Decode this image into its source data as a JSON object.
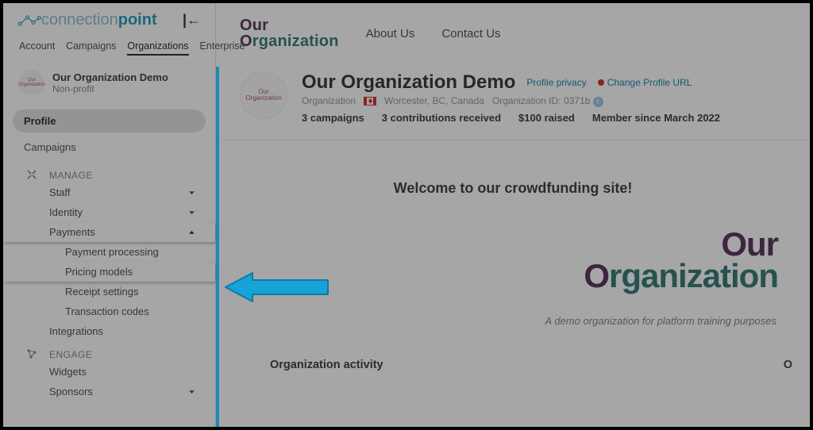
{
  "brand": {
    "logo_light": "connection",
    "logo_bold": "point",
    "org_word1": "Our",
    "org_word2": "Organization"
  },
  "top_tabs": [
    "Account",
    "Campaigns",
    "Organizations",
    "Enterprise"
  ],
  "top_tabs_active_index": 2,
  "sidebar": {
    "org_name": "Our Organization Demo",
    "org_type": "Non-profit",
    "profile_items": [
      "Profile",
      "Campaigns"
    ],
    "profile_active_index": 0,
    "manage_heading": "MANAGE",
    "manage_items": [
      {
        "label": "Staff",
        "expandable": true
      },
      {
        "label": "Identity",
        "expandable": true
      },
      {
        "label": "Payments",
        "expandable": true,
        "expanded": true,
        "children": [
          "Payment processing",
          "Pricing models",
          "Receipt settings",
          "Transaction codes"
        ],
        "highlight_child_index": 1
      },
      {
        "label": "Integrations",
        "expandable": false
      }
    ],
    "engage_heading": "ENGAGE",
    "engage_items": [
      {
        "label": "Widgets",
        "expandable": false
      },
      {
        "label": "Sponsors",
        "expandable": true
      }
    ]
  },
  "nav_links": [
    "About Us",
    "Contact Us"
  ],
  "profile": {
    "title": "Our Organization Demo",
    "privacy_link": "Profile privacy",
    "change_url_link": "Change Profile URL",
    "type": "Organization",
    "location": "Worcester, BC, Canada",
    "org_id_label": "Organization ID:",
    "org_id": "0371b",
    "stats": [
      "3 campaigns",
      "3 contributions received",
      "$100 raised",
      "Member since March 2022"
    ]
  },
  "welcome": "Welcome to our crowdfunding site!",
  "caption": "A demo organization for platform training purposes",
  "activity_heading": "Organization activity",
  "activity_right": "O"
}
